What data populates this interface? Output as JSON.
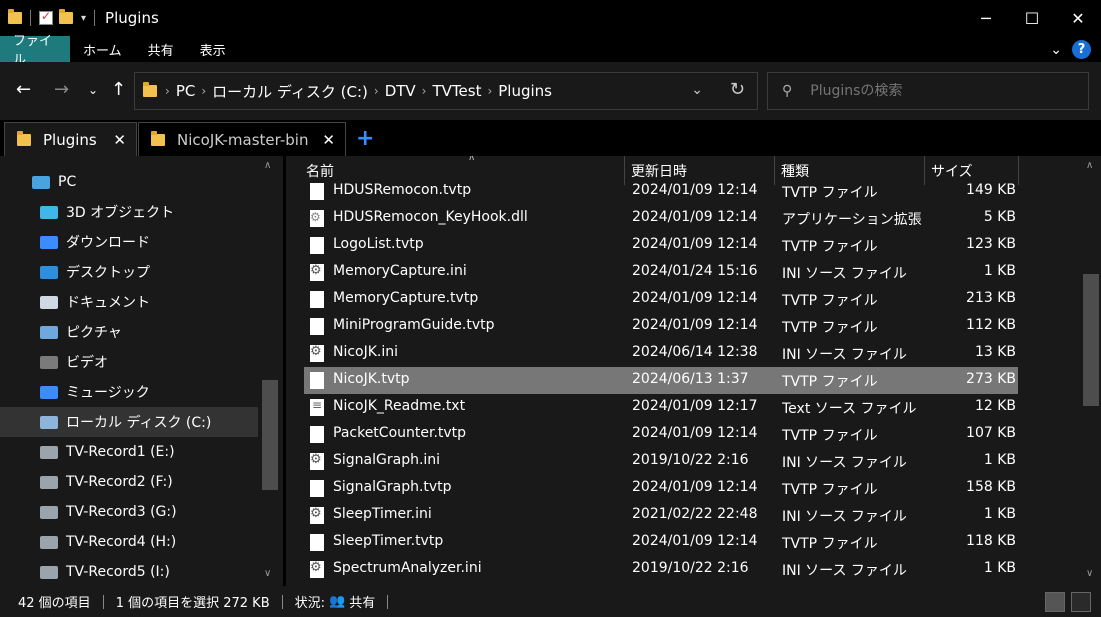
{
  "window": {
    "title": "Plugins",
    "controls": [
      "─",
      "☐",
      "✕"
    ]
  },
  "ribbon": {
    "tabs": [
      "ファイル",
      "ホーム",
      "共有",
      "表示"
    ]
  },
  "address": {
    "crumbs": [
      "PC",
      "ローカル ディスク (C:)",
      "DTV",
      "TVTest",
      "Plugins"
    ]
  },
  "search": {
    "placeholder": "Pluginsの検索"
  },
  "tabs": [
    {
      "label": "Plugins",
      "active": true
    },
    {
      "label": "NicoJK-master-bin",
      "active": false
    }
  ],
  "nav": {
    "items": [
      {
        "label": "PC",
        "icon": "pc-icon",
        "indent": 1
      },
      {
        "label": "3D オブジェクト",
        "icon": "3d-objects-icon",
        "indent": 2
      },
      {
        "label": "ダウンロード",
        "icon": "download-icon",
        "indent": 2
      },
      {
        "label": "デスクトップ",
        "icon": "desktop-icon",
        "indent": 2
      },
      {
        "label": "ドキュメント",
        "icon": "documents-icon",
        "indent": 2
      },
      {
        "label": "ピクチャ",
        "icon": "pictures-icon",
        "indent": 2
      },
      {
        "label": "ビデオ",
        "icon": "videos-icon",
        "indent": 2
      },
      {
        "label": "ミュージック",
        "icon": "music-icon",
        "indent": 2
      },
      {
        "label": "ローカル ディスク (C:)",
        "icon": "local-disk-icon",
        "indent": 2,
        "selected": true
      },
      {
        "label": "TV-Record1 (E:)",
        "icon": "drive-icon",
        "indent": 2
      },
      {
        "label": "TV-Record2 (F:)",
        "icon": "drive-icon",
        "indent": 2
      },
      {
        "label": "TV-Record3 (G:)",
        "icon": "drive-icon",
        "indent": 2
      },
      {
        "label": "TV-Record4 (H:)",
        "icon": "drive-icon",
        "indent": 2
      },
      {
        "label": "TV-Record5 (I:)",
        "icon": "drive-icon",
        "indent": 2
      }
    ]
  },
  "columns": {
    "name": "名前",
    "date": "更新日時",
    "type": "種類",
    "size": "サイズ"
  },
  "files": [
    {
      "name": "HDUSRemocon.tvtp",
      "date": "2024/01/09 12:14",
      "type": "TVTP ファイル",
      "size": "149 KB",
      "icon": "file"
    },
    {
      "name": "HDUSRemocon_KeyHook.dll",
      "date": "2024/01/09 12:14",
      "type": "アプリケーション拡張",
      "size": "5 KB",
      "icon": "dll"
    },
    {
      "name": "LogoList.tvtp",
      "date": "2024/01/09 12:14",
      "type": "TVTP ファイル",
      "size": "123 KB",
      "icon": "file"
    },
    {
      "name": "MemoryCapture.ini",
      "date": "2024/01/24 15:16",
      "type": "INI ソース ファイル",
      "size": "1 KB",
      "icon": "gear"
    },
    {
      "name": "MemoryCapture.tvtp",
      "date": "2024/01/09 12:14",
      "type": "TVTP ファイル",
      "size": "213 KB",
      "icon": "file"
    },
    {
      "name": "MiniProgramGuide.tvtp",
      "date": "2024/01/09 12:14",
      "type": "TVTP ファイル",
      "size": "112 KB",
      "icon": "file"
    },
    {
      "name": "NicoJK.ini",
      "date": "2024/06/14 12:38",
      "type": "INI ソース ファイル",
      "size": "13 KB",
      "icon": "gear"
    },
    {
      "name": "NicoJK.tvtp",
      "date": "2024/06/13 1:37",
      "type": "TVTP ファイル",
      "size": "273 KB",
      "icon": "file",
      "selected": true
    },
    {
      "name": "NicoJK_Readme.txt",
      "date": "2024/01/09 12:17",
      "type": "Text ソース ファイル",
      "size": "12 KB",
      "icon": "txt"
    },
    {
      "name": "PacketCounter.tvtp",
      "date": "2024/01/09 12:14",
      "type": "TVTP ファイル",
      "size": "107 KB",
      "icon": "file"
    },
    {
      "name": "SignalGraph.ini",
      "date": "2019/10/22 2:16",
      "type": "INI ソース ファイル",
      "size": "1 KB",
      "icon": "gear"
    },
    {
      "name": "SignalGraph.tvtp",
      "date": "2024/01/09 12:14",
      "type": "TVTP ファイル",
      "size": "158 KB",
      "icon": "file"
    },
    {
      "name": "SleepTimer.ini",
      "date": "2021/02/22 22:48",
      "type": "INI ソース ファイル",
      "size": "1 KB",
      "icon": "gear"
    },
    {
      "name": "SleepTimer.tvtp",
      "date": "2024/01/09 12:14",
      "type": "TVTP ファイル",
      "size": "118 KB",
      "icon": "file"
    },
    {
      "name": "SpectrumAnalyzer.ini",
      "date": "2019/10/22 2:16",
      "type": "INI ソース ファイル",
      "size": "1 KB",
      "icon": "gear"
    }
  ],
  "status": {
    "count": "42 個の項目",
    "selection": "1 個の項目を選択  272 KB",
    "state_label": "状況:",
    "state_value": "共有"
  }
}
